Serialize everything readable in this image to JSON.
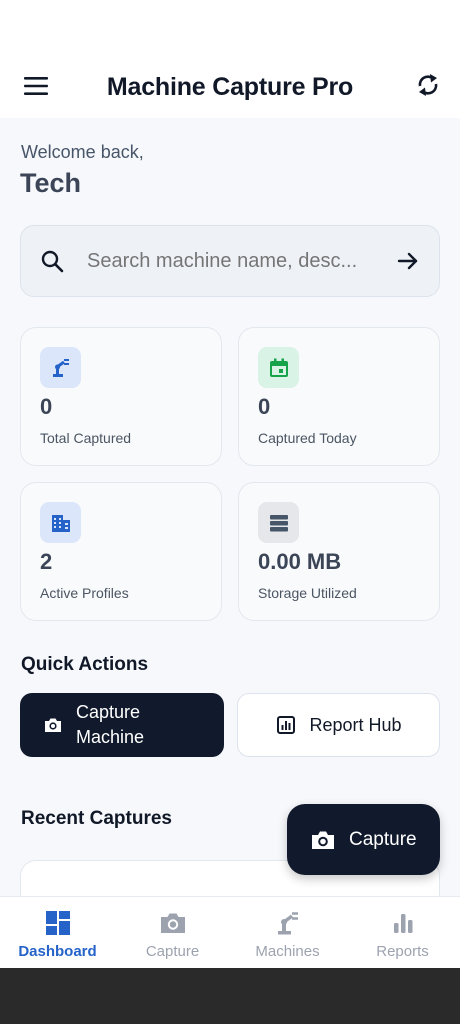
{
  "app_bar": {
    "title": "Machine Capture Pro",
    "menu_icon": "menu-icon",
    "sync_icon": "sync-icon"
  },
  "greeting": {
    "welcome": "Welcome back,",
    "name": "Tech"
  },
  "search": {
    "placeholder": "Search machine name, desc...",
    "icon": "search-icon",
    "go_icon": "arrow-right-icon"
  },
  "stats": [
    {
      "value": "0",
      "label": "Total Captured",
      "icon": "robot-arm-icon",
      "icon_bg": "#dbe6fb",
      "icon_color": "#2563c9"
    },
    {
      "value": "0",
      "label": "Captured Today",
      "icon": "calendar-icon",
      "icon_bg": "#d9f3e6",
      "icon_color": "#16a34a"
    },
    {
      "value": "2",
      "label": "Active Profiles",
      "icon": "building-icon",
      "icon_bg": "#dbe6fb",
      "icon_color": "#2563c9"
    },
    {
      "value": "0.00 MB",
      "label": "Storage Utilized",
      "icon": "storage-icon",
      "icon_bg": "#e5e7eb",
      "icon_color": "#475569"
    }
  ],
  "quick_actions": {
    "title": "Quick Actions",
    "capture_label": "Capture Machine",
    "report_label": "Report Hub"
  },
  "recent": {
    "title": "Recent Captures"
  },
  "fab": {
    "label": "Capture"
  },
  "nav": [
    {
      "label": "Dashboard",
      "icon": "dashboard-icon",
      "active": true
    },
    {
      "label": "Capture",
      "icon": "camera-icon",
      "active": false
    },
    {
      "label": "Machines",
      "icon": "robot-arm-icon",
      "active": false
    },
    {
      "label": "Reports",
      "icon": "bar-chart-icon",
      "active": false
    }
  ],
  "colors": {
    "primary_dark": "#111a2c",
    "accent_blue": "#2563c9",
    "background": "#f6f8fb"
  }
}
